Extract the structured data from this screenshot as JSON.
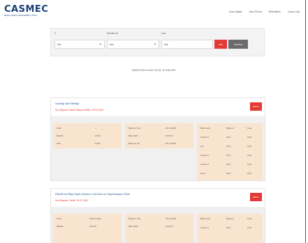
{
  "logo": {
    "name": "CASMEC",
    "tagline": "MEDIA & EVENT MANAGEMENT TOOLS"
  },
  "nav": [
    "Ana Sayfa",
    "Ana Firma",
    "Etkinlikler",
    "Çıkış Yap"
  ],
  "search": {
    "fields": [
      {
        "label": "İl",
        "value": "Ara"
      },
      {
        "label": "Etkinlik Ad",
        "value": "Ara"
      },
      {
        "label": "Kod",
        "value": "Ara"
      }
    ],
    "search_button": "ARA",
    "clear_button": "TEMİZLE"
  },
  "section_title": "BAŞVURULAN AÇIK İLANLAR",
  "cards": [
    {
      "title": "Sandığı ilan Etkinliği",
      "subtitle": "Son Başvuru Tarihi: Başvuru Bitiş: 15.01.2020",
      "button": "DETAY",
      "left_rows": [
        [
          "İl Adı",
          "–"
        ],
        [
          "Etkinlik",
          "0.000"
        ],
        [
          "Süre",
          "0.000"
        ]
      ],
      "mid_rows": [
        [
          "Başvuru Kod",
          "15.12.2019"
        ],
        [
          "Bitiş Tarihi",
          "0.00.0.0"
        ],
        [
          "Başvuru Sa.",
          "15.12.2019"
        ]
      ],
      "right_header": [
        "Bölüm Adı",
        "Başvuru",
        "Kota"
      ],
      "right_rows": [
        [
          "Görevli 1",
          "0.00",
          "0.00"
        ],
        [
          "Ulu",
          "0.00",
          "0.00"
        ],
        [
          "Görevli 2",
          "0.00",
          "0.00"
        ],
        [
          "Görevli 3",
          "0.00",
          "0.00"
        ],
        [
          "Ulu 2",
          "0.00",
          "0.00"
        ]
      ]
    },
    {
      "title": "Etkinlik Ad Bilgi Sayfa Kullanıcı Görevlisi ve Organizasyon Ekibi",
      "subtitle": "Son Başvuru Tarihi: 15.01.2020",
      "button": "DETAY",
      "left_rows": [
        [
          "İl Adı",
          "Toplu Kodlar"
        ],
        [
          "Etkinlik",
          "0.00.00"
        ]
      ],
      "mid_rows": [
        [
          "Başvuru Kod",
          "15.01.2020"
        ],
        [
          "Bitiş Tarihi",
          "0.00.0.0"
        ]
      ],
      "right_header": [
        "Bölüm Adı",
        "Başvuru",
        "Kota"
      ],
      "right_rows": [
        [
          "Görevli 1",
          "0.00",
          "0.00"
        ]
      ]
    }
  ],
  "colors": {
    "brand": "#1b3f78",
    "accent": "#e53935",
    "panel": "#f8e4cf"
  }
}
